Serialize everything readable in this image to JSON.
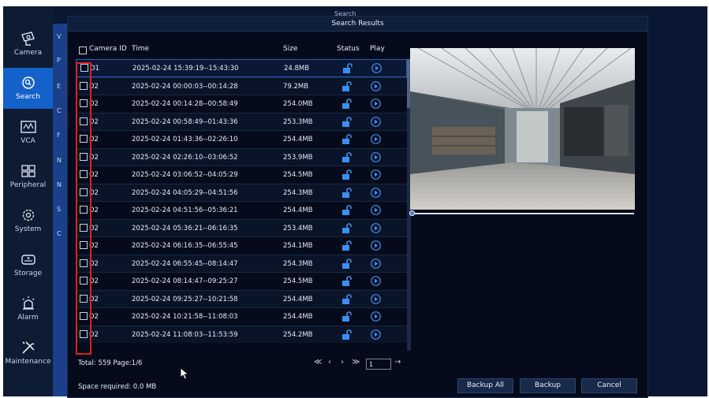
{
  "sidebar": {
    "items": [
      {
        "label": "Camera",
        "icon": "camera-icon"
      },
      {
        "label": "Search",
        "icon": "search-icon",
        "active": true
      },
      {
        "label": "VCA",
        "icon": "vca-icon"
      },
      {
        "label": "Peripheral",
        "icon": "peripheral-icon"
      },
      {
        "label": "System",
        "icon": "gear-icon"
      },
      {
        "label": "Storage",
        "icon": "storage-icon"
      },
      {
        "label": "Alarm",
        "icon": "alarm-icon"
      },
      {
        "label": "Maintenance",
        "icon": "wrench-icon"
      }
    ]
  },
  "background": {
    "title": "Search",
    "letters": [
      "V",
      "P",
      "E",
      "C",
      "F",
      "N",
      "N",
      "S",
      "C"
    ]
  },
  "dialog": {
    "title": "Search Results",
    "columns": {
      "camera_id": "Camera ID",
      "time": "Time",
      "size": "Size",
      "status": "Status",
      "play": "Play"
    },
    "rows": [
      {
        "cam": "D1",
        "time": "2025-02-24 15:39:19--15:43:30",
        "size": "24.8MB"
      },
      {
        "cam": "D2",
        "time": "2025-02-24 00:00:03--00:14:28",
        "size": "79.2MB"
      },
      {
        "cam": "D2",
        "time": "2025-02-24 00:14:28--00:58:49",
        "size": "254.0MB"
      },
      {
        "cam": "D2",
        "time": "2025-02-24 00:58:49--01:43:36",
        "size": "253.3MB"
      },
      {
        "cam": "D2",
        "time": "2025-02-24 01:43:36--02:26:10",
        "size": "254.4MB"
      },
      {
        "cam": "D2",
        "time": "2025-02-24 02:26:10--03:06:52",
        "size": "253.9MB"
      },
      {
        "cam": "D2",
        "time": "2025-02-24 03:06:52--04:05:29",
        "size": "254.5MB"
      },
      {
        "cam": "D2",
        "time": "2025-02-24 04:05:29--04:51:56",
        "size": "254.3MB"
      },
      {
        "cam": "D2",
        "time": "2025-02-24 04:51:56--05:36:21",
        "size": "254.4MB"
      },
      {
        "cam": "D2",
        "time": "2025-02-24 05:36:21--06:16:35",
        "size": "253.4MB"
      },
      {
        "cam": "D2",
        "time": "2025-02-24 06:16:35--06:55:45",
        "size": "254.1MB"
      },
      {
        "cam": "D2",
        "time": "2025-02-24 06:55:45--08:14:47",
        "size": "254.3MB"
      },
      {
        "cam": "D2",
        "time": "2025-02-24 08:14:47--09:25:27",
        "size": "254.5MB"
      },
      {
        "cam": "D2",
        "time": "2025-02-24 09:25:27--10:21:58",
        "size": "254.4MB"
      },
      {
        "cam": "D2",
        "time": "2025-02-24 10:21:58--11:08:03",
        "size": "254.4MB"
      },
      {
        "cam": "D2",
        "time": "2025-02-24 11:08:03--11:53:59",
        "size": "254.2MB"
      }
    ],
    "status_icon": "unlock-icon",
    "play_icon": "play-icon",
    "total_text": "Total: 559  Page:1/6",
    "page_value": "1",
    "space_text": "Space required: 0.0 MB",
    "buttons": {
      "backup_all": "Backup All",
      "backup": "Backup",
      "cancel": "Cancel"
    },
    "pager": {
      "first": "≪",
      "prev": "‹",
      "next": "›",
      "last": "≫",
      "go": "→"
    },
    "playback_progress": 0.0
  },
  "colors": {
    "accent": "#1361c9",
    "highlight": "#e02020",
    "dialog_bg": "#050b1a"
  }
}
